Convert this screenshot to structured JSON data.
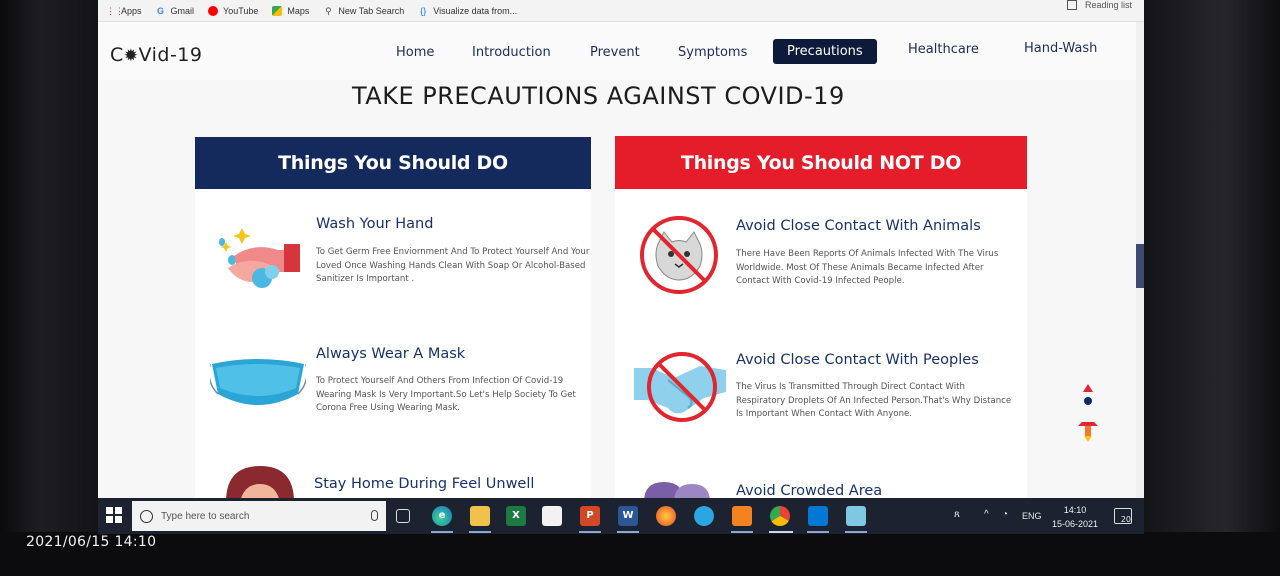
{
  "photo_timestamp": "2021/06/15 14:10",
  "bookmarks": [
    {
      "label": "Apps",
      "icon": "apps-grid-icon",
      "color": "#d93025"
    },
    {
      "label": "Gmail",
      "icon": "google-icon",
      "color": "#4285f4"
    },
    {
      "label": "YouTube",
      "icon": "youtube-icon",
      "color": "#ff0000"
    },
    {
      "label": "Maps",
      "icon": "maps-icon",
      "color": "#34a853"
    },
    {
      "label": "New Tab Search",
      "icon": "search-icon",
      "color": "#555555"
    },
    {
      "label": "Visualize data from...",
      "icon": "code-braces-icon",
      "color": "#1a73e8"
    }
  ],
  "reading_list": "Reading list",
  "site": {
    "logo_prefix": "C",
    "logo_suffix": "Vid-19",
    "nav": [
      {
        "label": "Home",
        "active": false
      },
      {
        "label": "Introduction",
        "active": false
      },
      {
        "label": "Prevent",
        "active": false
      },
      {
        "label": "Symptoms",
        "active": false
      },
      {
        "label": "Precautions",
        "active": true
      },
      {
        "label": "Healthcare",
        "active": false
      },
      {
        "label": "Hand-Wash",
        "active": false
      }
    ],
    "page_title": "TAKE PRECAUTIONS AGAINST COVID-19",
    "do_header": "Things You Should DO",
    "dont_header": "Things You Should NOT DO",
    "do_items": [
      {
        "title": "Wash Your Hand",
        "desc": "To Get Germ Free Enviornment And To Protect Yourself And Your Loved Once Washing Hands Clean With Soap Or Alcohol-Based Sanitizer Is Important ."
      },
      {
        "title": "Always Wear A Mask",
        "desc": "To Protect Yourself And Others From Infection Of Covid-19 Wearing Mask Is Very Important.So Let's Help Society To Get Corona Free Using Wearing Mask."
      },
      {
        "title": "Stay Home During Feel Unwell",
        "desc": ""
      }
    ],
    "dont_items": [
      {
        "title": "Avoid Close Contact With Animals",
        "desc": "There Have Been Reports Of Animals Infected With The Virus Worldwide. Most Of These Animals Became Infected After Contact With Covid-19 Infected People."
      },
      {
        "title": "Avoid Close Contact With Peoples",
        "desc": "The Virus Is Transmitted Through Direct Contact With Respiratory Droplets Of An Infected Person.That's Why Distance Is Important When Contact With Anyone."
      },
      {
        "title": "Avoid Crowded Area",
        "desc": ""
      }
    ],
    "colors": {
      "primary": "#152a5c",
      "danger": "#e51d2a",
      "title_blue": "#17336b"
    }
  },
  "taskbar": {
    "search_placeholder": "Type here to search",
    "apps": [
      {
        "name": "task-view-icon",
        "label": ""
      },
      {
        "name": "edge-icon",
        "label": "e"
      },
      {
        "name": "file-explorer-icon",
        "label": ""
      },
      {
        "name": "excel-icon",
        "label": "X"
      },
      {
        "name": "store-icon",
        "label": ""
      },
      {
        "name": "powerpoint-icon",
        "label": "P"
      },
      {
        "name": "word-icon",
        "label": "W"
      },
      {
        "name": "firefox-icon",
        "label": ""
      },
      {
        "name": "telegram-icon",
        "label": ""
      },
      {
        "name": "xampp-icon",
        "label": ""
      },
      {
        "name": "chrome-icon",
        "label": ""
      },
      {
        "name": "vscode-icon",
        "label": ""
      },
      {
        "name": "notepad-icon",
        "label": ""
      }
    ],
    "language": "ENG",
    "time": "14:10",
    "date": "15-06-2021",
    "notification_count": "20"
  }
}
